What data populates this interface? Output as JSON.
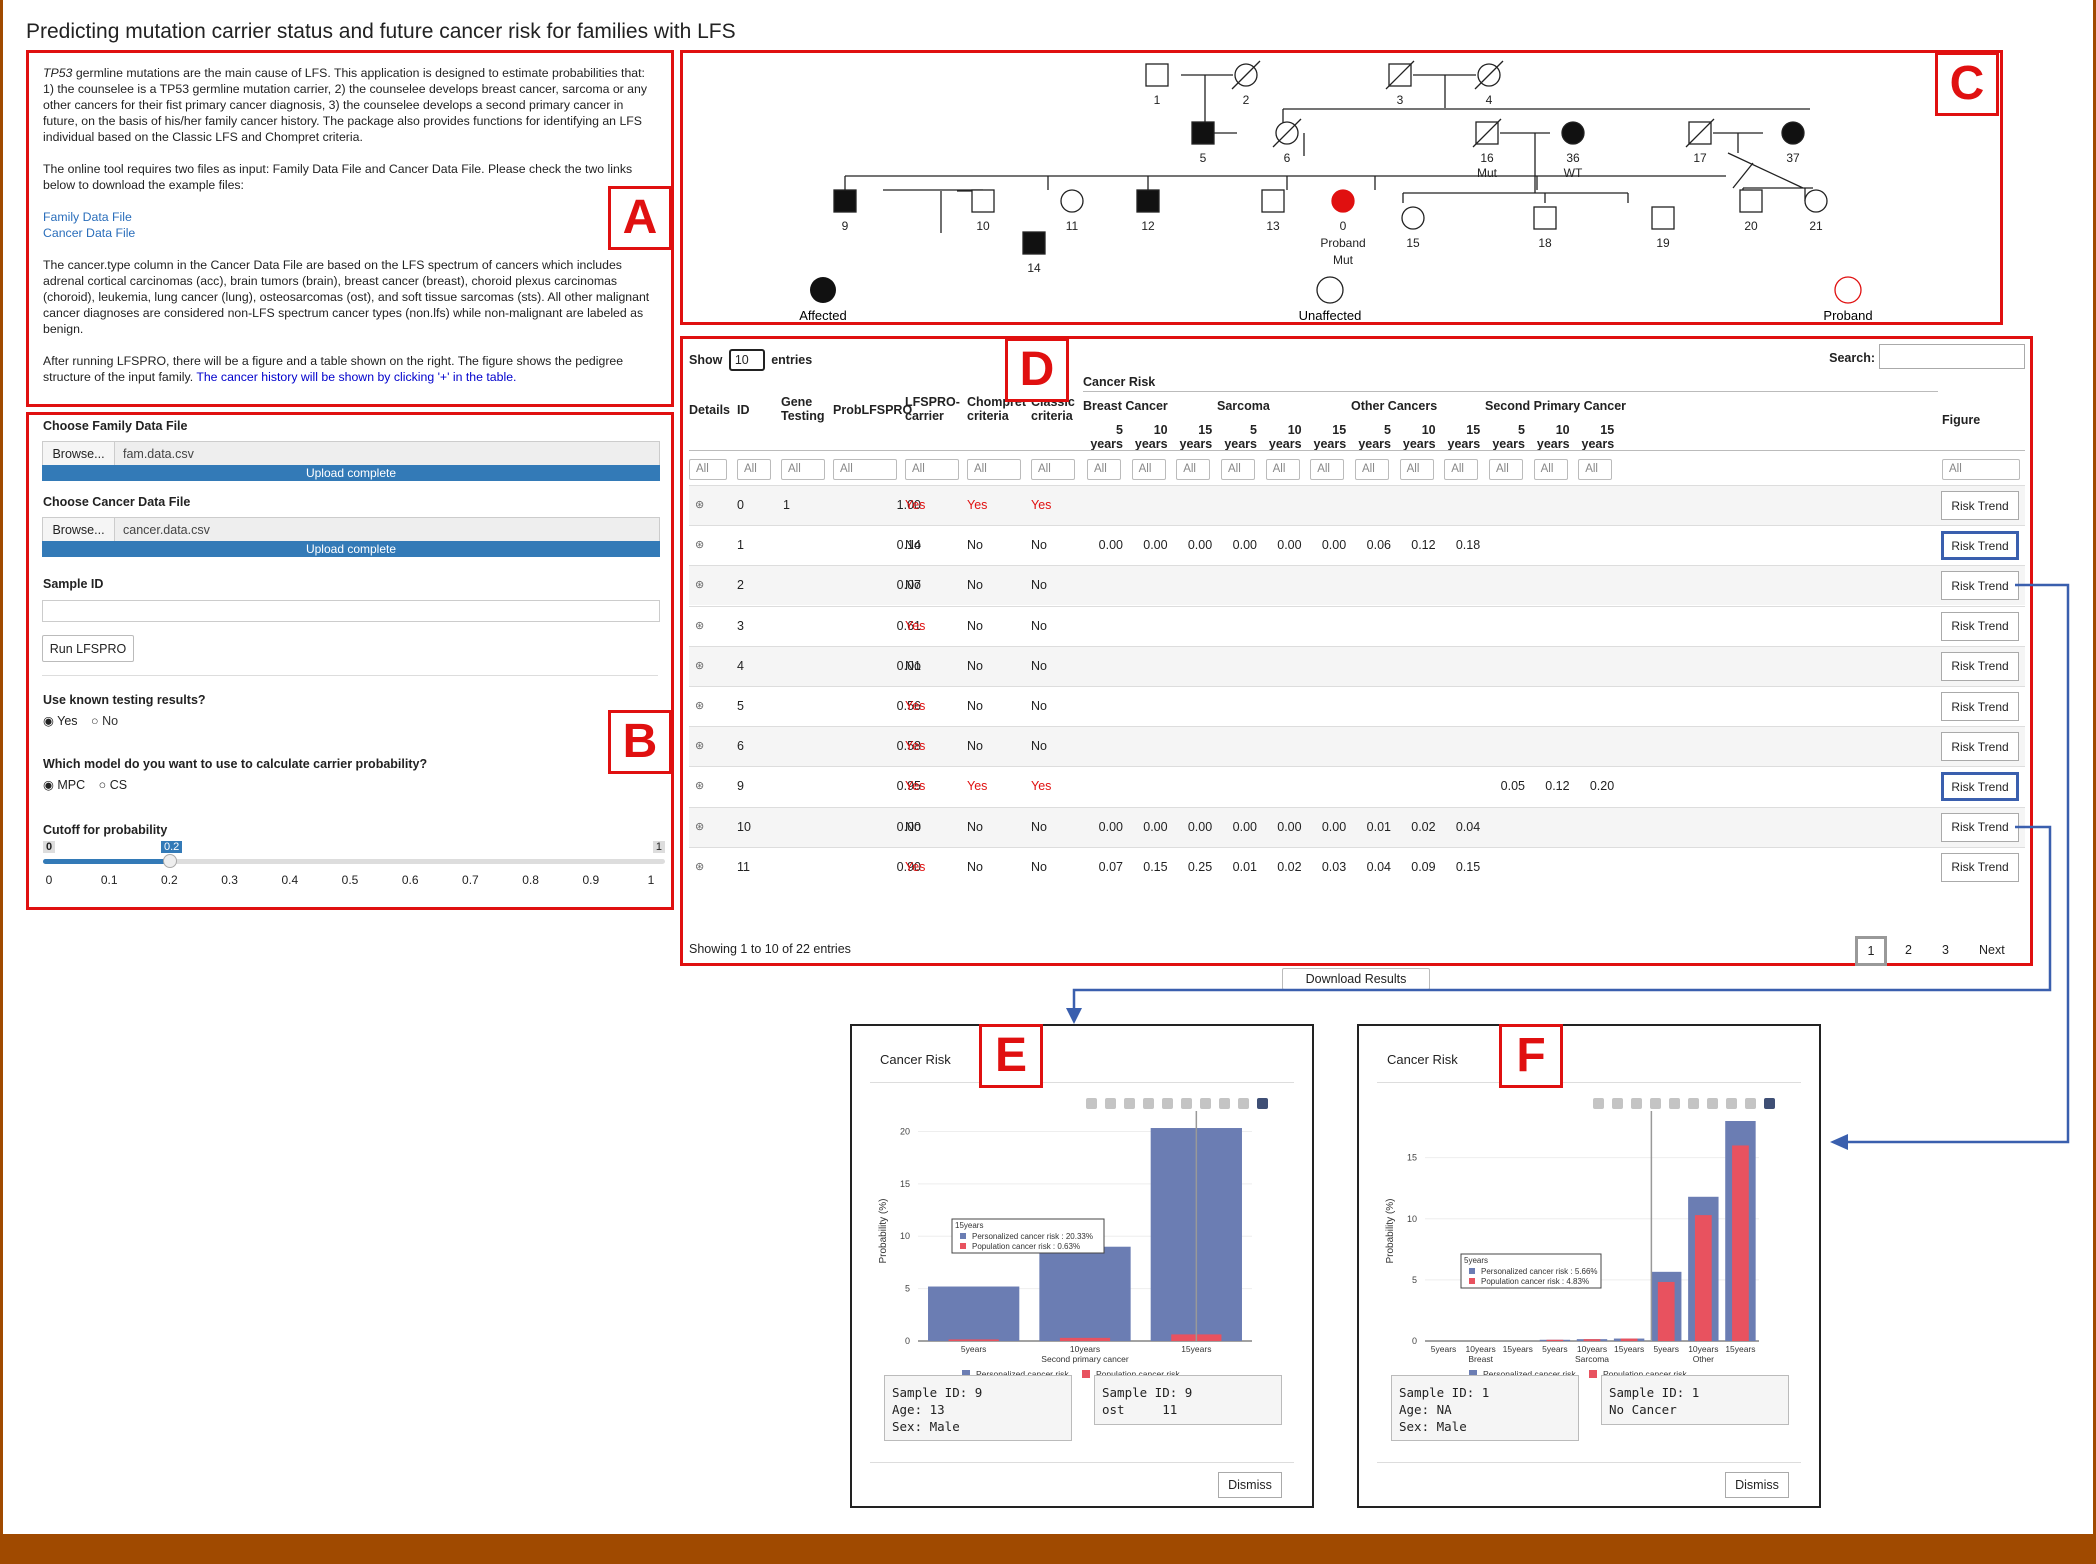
{
  "title": "Predicting mutation carrier status and future cancer risk for families with LFS",
  "labels": {
    "a": "A",
    "b": "B",
    "c": "C",
    "d": "D",
    "e": "E",
    "f": "F"
  },
  "panel_a": {
    "p1_pre": "TP53",
    "p1": " germline mutations are the main cause of LFS. This application is designed to estimate probabilities that: 1) the counselee is a TP53 germline mutation carrier, 2) the counselee develops breast cancer, sarcoma or any other cancers for their fist primary cancer diagnosis, 3) the counselee develops a second primary cancer in future, on the basis of his/her family cancer history. The package also provides functions for identifying an LFS individual based on the Classic LFS and Chompret criteria.",
    "p2": "The online tool requires two files as input: Family Data File and Cancer Data File. Please check the two links below to download the example files:",
    "link1": "Family Data File",
    "link2": "Cancer Data File",
    "p3": "The cancer.type column in the Cancer Data File are based on the LFS spectrum of cancers which includes adrenal cortical carcinomas (acc), brain tumors (brain), breast cancer (breast), choroid plexus carcinomas (choroid), leukemia, lung cancer (lung), osteosarcomas (ost), and soft tissue sarcomas (sts). All other malignant cancer diagnoses are considered non-LFS spectrum cancer types (non.lfs) while non-malignant are labeled as benign.",
    "p4": "After running LFSPRO, there will be a figure and a table shown on the right. The figure shows the pedigree structure of the input family. ",
    "p4_blue": "The cancer history will be shown by clicking '+' in the table."
  },
  "panel_b": {
    "fam_label": "Choose Family Data File",
    "browse": "Browse...",
    "fam_file": "fam.data.csv",
    "upload": "Upload complete",
    "cancer_label": "Choose Cancer Data File",
    "cancer_file": "cancer.data.csv",
    "sample_label": "Sample ID",
    "run": "Run LFSPRO",
    "known_label": "Use known testing results?",
    "yes": "Yes",
    "no": "No",
    "model_label": "Which model do you want to use to calculate carrier probability?",
    "mpc": "MPC",
    "cs": "CS",
    "cutoff_label": "Cutoff for probability",
    "slider_min": "0",
    "slider_val": "0.2",
    "slider_max": "1",
    "ticks": [
      "0",
      "0.1",
      "0.2",
      "0.3",
      "0.4",
      "0.5",
      "0.6",
      "0.7",
      "0.8",
      "0.9",
      "1"
    ]
  },
  "pedigree": {
    "ids": [
      "1",
      "2",
      "3",
      "4",
      "5",
      "6",
      "16",
      "36",
      "17",
      "37",
      "9",
      "10",
      "11",
      "12",
      "13",
      "0",
      "15",
      "18",
      "19",
      "20",
      "21",
      "14"
    ],
    "proband": "Proband",
    "mut": "Mut",
    "wt": "WT",
    "legend": [
      "Affected",
      "Unaffected",
      "Proband"
    ]
  },
  "table": {
    "show": "Show",
    "show_n": "10",
    "entries": "entries",
    "search": "Search:",
    "cancer_risk": "Cancer Risk",
    "groups": [
      "Breast Cancer",
      "Sarcoma",
      "Other Cancers",
      "Second Primary Cancer"
    ],
    "cols": [
      "Details",
      "ID",
      "Gene Testing",
      "ProbLFSPRO",
      "LFSPRO-carrier",
      "Chompret criteria",
      "Classic criteria"
    ],
    "years": [
      "5 years",
      "10 years",
      "15 years"
    ],
    "figure": "Figure",
    "all": "All",
    "risk_trend": "Risk Trend",
    "rows": [
      {
        "id": "0",
        "gt": "1",
        "prob": "1.00",
        "car": "Yes",
        "chom": "Yes",
        "cls": "Yes",
        "r": [
          "",
          "",
          "",
          "",
          "",
          "",
          "",
          "",
          "",
          "",
          "",
          ""
        ]
      },
      {
        "id": "1",
        "gt": "",
        "prob": "0.14",
        "car": "No",
        "chom": "No",
        "cls": "No",
        "r": [
          "0.00",
          "0.00",
          "0.00",
          "0.00",
          "0.00",
          "0.00",
          "0.06",
          "0.12",
          "0.18",
          "",
          "",
          ""
        ]
      },
      {
        "id": "2",
        "gt": "",
        "prob": "0.07",
        "car": "No",
        "chom": "No",
        "cls": "No",
        "r": [
          "",
          "",
          "",
          "",
          "",
          "",
          "",
          "",
          "",
          "",
          "",
          ""
        ]
      },
      {
        "id": "3",
        "gt": "",
        "prob": "0.61",
        "car": "Yes",
        "chom": "No",
        "cls": "No",
        "r": [
          "",
          "",
          "",
          "",
          "",
          "",
          "",
          "",
          "",
          "",
          "",
          ""
        ]
      },
      {
        "id": "4",
        "gt": "",
        "prob": "0.01",
        "car": "No",
        "chom": "No",
        "cls": "No",
        "r": [
          "",
          "",
          "",
          "",
          "",
          "",
          "",
          "",
          "",
          "",
          "",
          ""
        ]
      },
      {
        "id": "5",
        "gt": "",
        "prob": "0.56",
        "car": "Yes",
        "chom": "No",
        "cls": "No",
        "r": [
          "",
          "",
          "",
          "",
          "",
          "",
          "",
          "",
          "",
          "",
          "",
          ""
        ]
      },
      {
        "id": "6",
        "gt": "",
        "prob": "0.58",
        "car": "Yes",
        "chom": "No",
        "cls": "No",
        "r": [
          "",
          "",
          "",
          "",
          "",
          "",
          "",
          "",
          "",
          "",
          "",
          ""
        ]
      },
      {
        "id": "9",
        "gt": "",
        "prob": "0.95",
        "car": "Yes",
        "chom": "Yes",
        "cls": "Yes",
        "r": [
          "",
          "",
          "",
          "",
          "",
          "",
          "",
          "",
          "",
          "0.05",
          "0.12",
          "0.20"
        ]
      },
      {
        "id": "10",
        "gt": "",
        "prob": "0.00",
        "car": "No",
        "chom": "No",
        "cls": "No",
        "r": [
          "0.00",
          "0.00",
          "0.00",
          "0.00",
          "0.00",
          "0.00",
          "0.01",
          "0.02",
          "0.04",
          "",
          "",
          ""
        ]
      },
      {
        "id": "11",
        "gt": "",
        "prob": "0.90",
        "car": "Yes",
        "chom": "No",
        "cls": "No",
        "r": [
          "0.07",
          "0.15",
          "0.25",
          "0.01",
          "0.02",
          "0.03",
          "0.04",
          "0.09",
          "0.15",
          "",
          "",
          ""
        ]
      }
    ],
    "showing": "Showing 1 to 10 of 22 entries",
    "pages": [
      "1",
      "2",
      "3"
    ],
    "next": "Next",
    "download": "Download Results"
  },
  "modal_e": {
    "title": "Cancer Risk",
    "info1": "Sample ID: 9\nAge: 13\nSex: Male",
    "info2": "Sample ID: 9\nost     11",
    "dismiss": "Dismiss",
    "tooltip_title": "15years",
    "tooltip_p": "Personalized cancer risk : 20.33%",
    "tooltip_q": "Population cancer risk : 0.63%"
  },
  "modal_f": {
    "title": "Cancer Risk",
    "info1": "Sample ID: 1\nAge: NA\nSex: Male",
    "info2": "Sample ID: 1\nNo Cancer",
    "dismiss": "Dismiss",
    "tooltip_title": "5years",
    "tooltip_p": "Personalized cancer risk : 5.66%",
    "tooltip_q": "Population cancer risk : 4.83%"
  },
  "chart_data": [
    {
      "type": "bar",
      "categories": [
        "5years",
        "10years",
        "15years"
      ],
      "group_label": "Second primary cancer",
      "series": [
        {
          "name": "Personalized cancer risk",
          "values": [
            5.2,
            9.0,
            20.33
          ],
          "color": "#6b7db3"
        },
        {
          "name": "Population cancer risk",
          "values": [
            0.15,
            0.3,
            0.63
          ],
          "color": "#e8525f"
        }
      ],
      "ylabel": "Probability (%)",
      "ylim": [
        0,
        21
      ],
      "yticks": [
        0,
        5,
        10,
        15,
        20
      ],
      "legend": "bottom"
    },
    {
      "type": "bar",
      "categories": [
        "5years",
        "10years",
        "15years",
        "5years",
        "10years",
        "15years",
        "5years",
        "10years",
        "15years"
      ],
      "group_labels": [
        "Breast",
        "Sarcoma",
        "Other"
      ],
      "series": [
        {
          "name": "Personalized cancer risk",
          "values": [
            0,
            0,
            0,
            0.1,
            0.15,
            0.2,
            5.66,
            11.8,
            18.0
          ],
          "color": "#6b7db3"
        },
        {
          "name": "Population cancer risk",
          "values": [
            0,
            0,
            0,
            0.1,
            0.15,
            0.2,
            4.83,
            10.3,
            16.0
          ],
          "color": "#e8525f"
        }
      ],
      "ylabel": "Probability (%)",
      "ylim": [
        0,
        18
      ],
      "yticks": [
        0,
        5,
        10,
        15
      ],
      "legend": "bottom"
    }
  ]
}
